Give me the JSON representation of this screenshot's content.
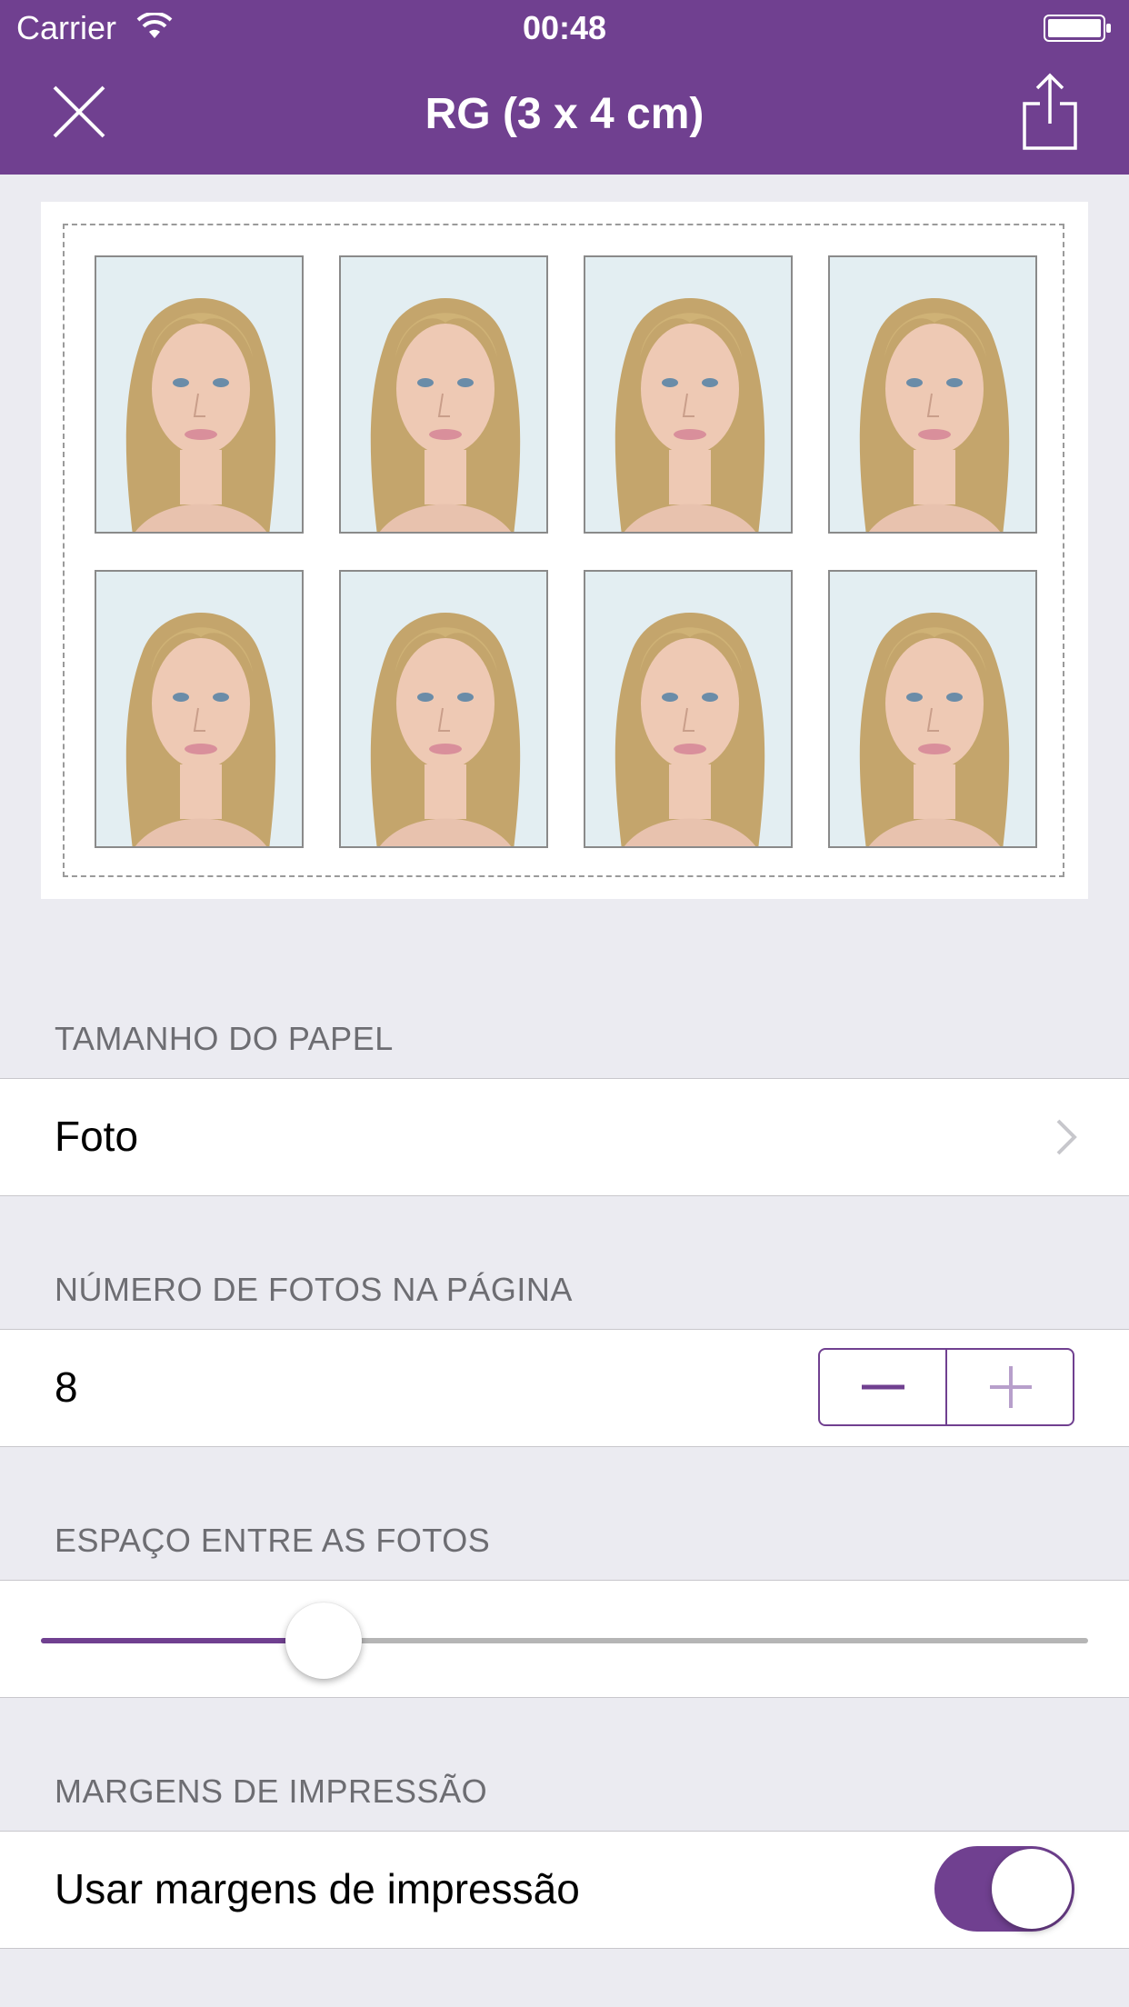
{
  "status_bar": {
    "carrier": "Carrier",
    "time": "00:48"
  },
  "nav": {
    "title": "RG (3 x 4 cm)"
  },
  "preview": {
    "photo_count": 8
  },
  "sections": {
    "paper_size": {
      "label": "TAMANHO DO PAPEL",
      "value": "Foto"
    },
    "photo_count": {
      "label": "NÚMERO DE FOTOS NA PÁGINA",
      "value": "8"
    },
    "spacing": {
      "label": "ESPAÇO ENTRE AS FOTOS",
      "slider_fraction": 0.27
    },
    "margins": {
      "label": "MARGENS DE IMPRESSÃO",
      "toggle_label": "Usar margens de impressão",
      "toggle_on": true
    }
  },
  "colors": {
    "accent": "#704090",
    "background": "#ebebf1"
  },
  "icons": {
    "close": "close-icon",
    "share": "share-icon",
    "chevron": "chevron-right-icon",
    "minus": "minus-icon",
    "plus": "plus-icon"
  }
}
